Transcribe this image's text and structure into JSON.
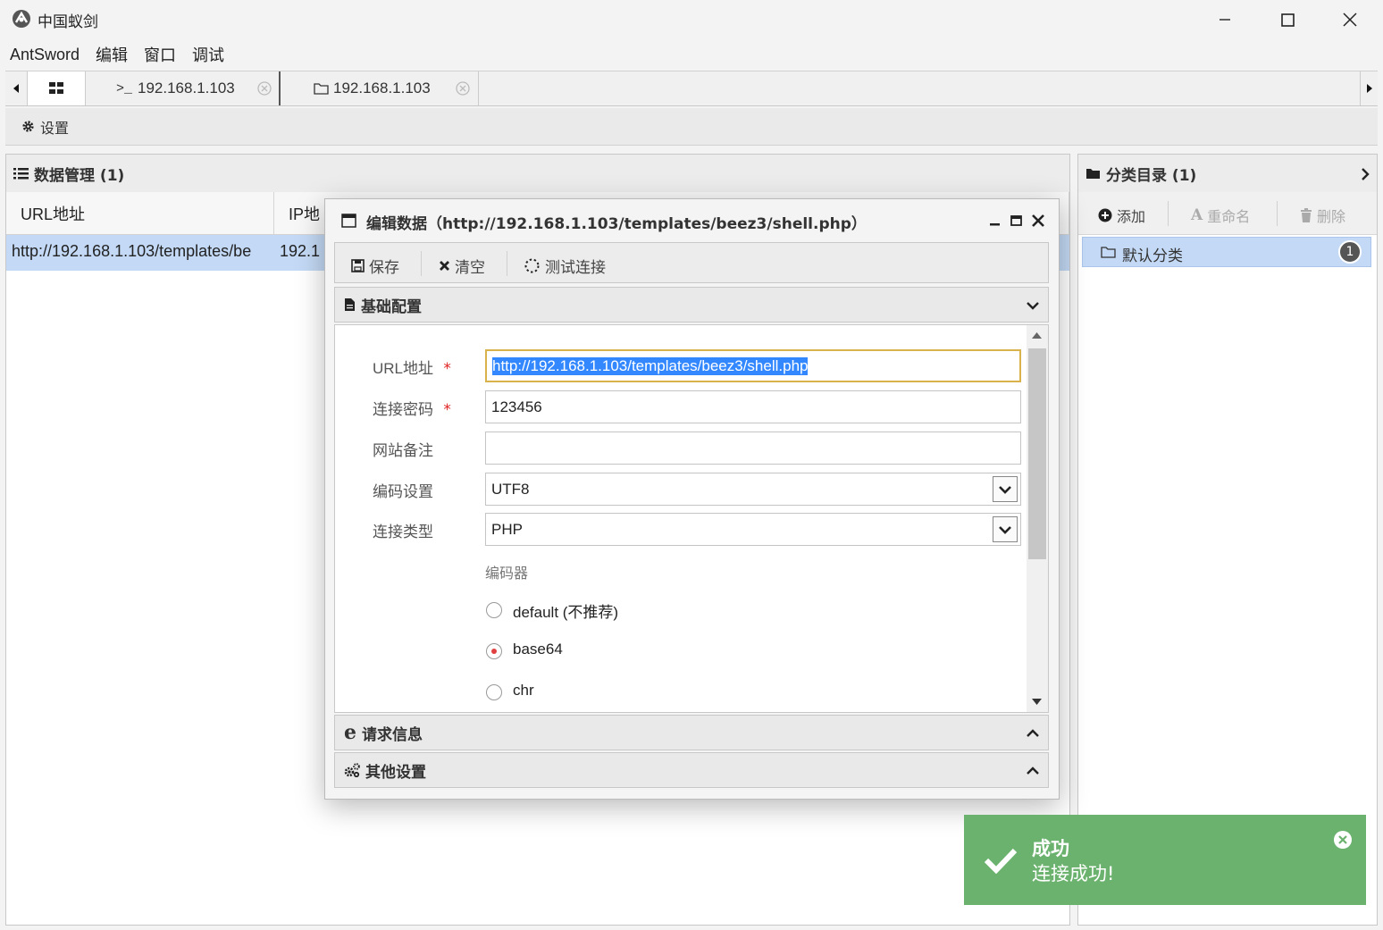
{
  "window": {
    "title": "中国蚁剑"
  },
  "menu": [
    "AntSword",
    "编辑",
    "窗口",
    "调试"
  ],
  "tabs": [
    {
      "label": "192.168.1.103",
      "prefix": ">_"
    },
    {
      "label": "192.168.1.103"
    }
  ],
  "toolbar": {
    "settings_label": "设置"
  },
  "data_panel": {
    "title": "数据管理 (1)",
    "columns": [
      "URL地址",
      "IP地"
    ],
    "rows": [
      {
        "url": "http://192.168.1.103/templates/be",
        "ip": "192.1"
      }
    ]
  },
  "category_panel": {
    "title": "分类目录 (1)",
    "add_label": "添加",
    "rename_label": "重命名",
    "delete_label": "删除",
    "items": [
      {
        "label": "默认分类",
        "count": "1"
      }
    ]
  },
  "dialog": {
    "title": "编辑数据（http://192.168.1.103/templates/beez3/shell.php）",
    "save_label": "保存",
    "clear_label": "清空",
    "test_label": "测试连接",
    "section_basic": "基础配置",
    "section_request": "请求信息",
    "section_other": "其他设置",
    "form": {
      "url_label": "URL地址",
      "url_value": "http://192.168.1.103/templates/beez3/shell.php",
      "password_label": "连接密码",
      "password_value": "123456",
      "note_label": "网站备注",
      "note_value": "",
      "encoding_label": "编码设置",
      "encoding_value": "UTF8",
      "type_label": "连接类型",
      "type_value": "PHP",
      "encoder_label": "编码器",
      "required_mark": "*",
      "encoders": [
        {
          "label": "default (不推荐)",
          "checked": false
        },
        {
          "label": "base64",
          "checked": true
        },
        {
          "label": "chr",
          "checked": false
        }
      ]
    }
  },
  "toast": {
    "title": "成功",
    "message": "连接成功!",
    "color": "#6cb26f"
  },
  "colors": {
    "selection": "#3388ff",
    "row_selected": "#c3d9f5",
    "required": "#e02020",
    "input_focus_border": "#d9b24b"
  }
}
